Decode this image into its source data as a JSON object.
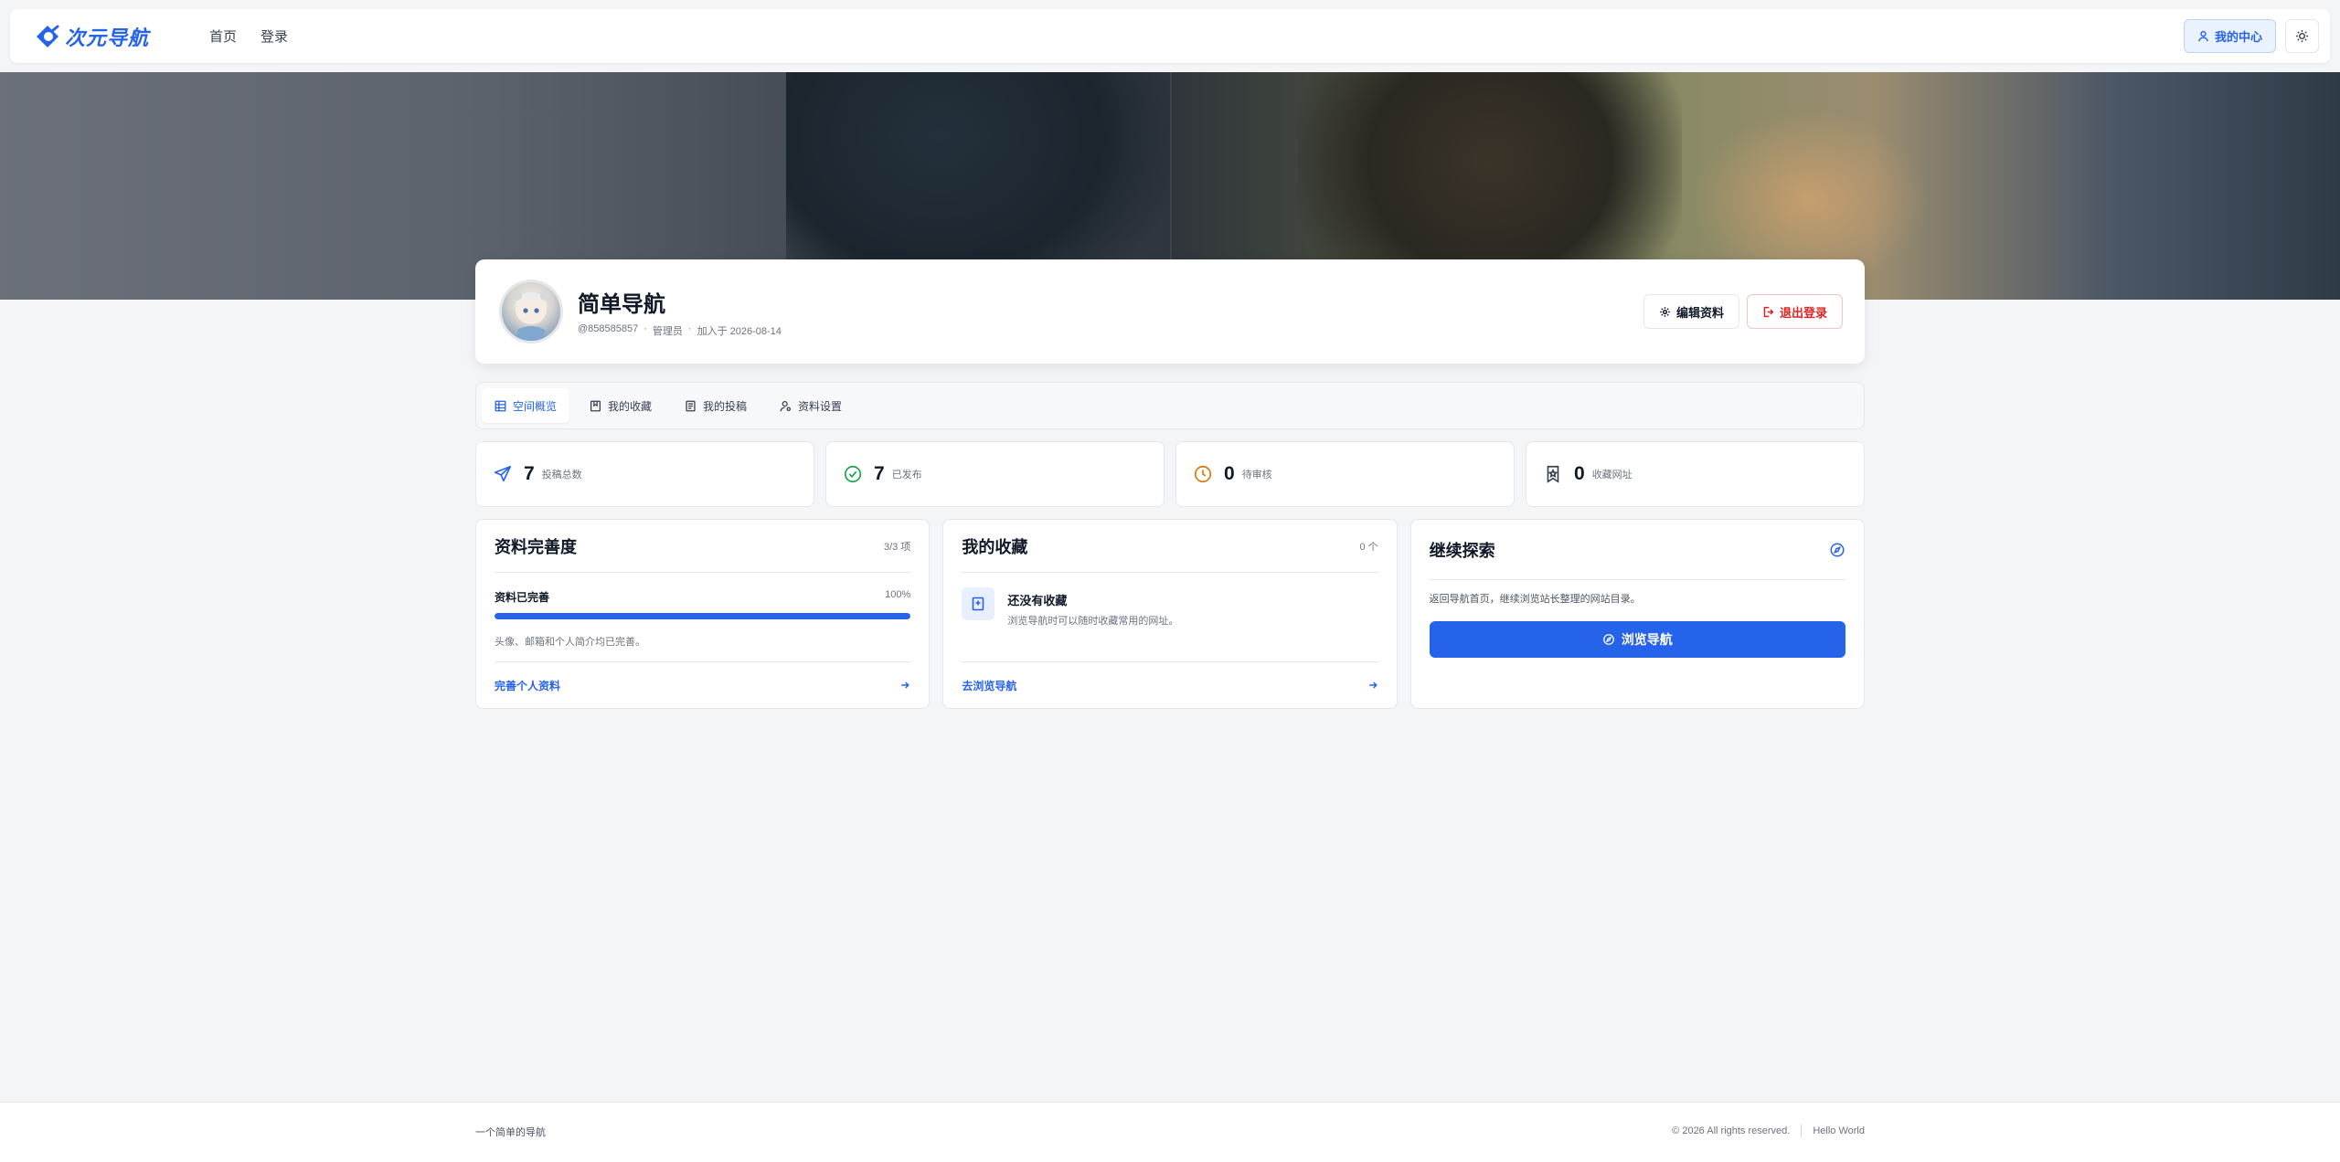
{
  "header": {
    "logo_text": "次元导航",
    "nav": [
      "首页",
      "登录"
    ],
    "center_label": "我的中心"
  },
  "profile": {
    "name": "简单导航",
    "handle": "@858585857",
    "role": "管理员",
    "joined": "加入于 2026-08-14",
    "edit_label": "编辑资料",
    "logout_label": "退出登录"
  },
  "tabs": [
    {
      "label": "空间概览",
      "icon": "grid-icon",
      "active": true
    },
    {
      "label": "我的收藏",
      "icon": "bookmark-icon",
      "active": false
    },
    {
      "label": "我的投稿",
      "icon": "document-icon",
      "active": false
    },
    {
      "label": "资料设置",
      "icon": "user-settings-icon",
      "active": false
    }
  ],
  "stats": [
    {
      "value": "7",
      "label": "投稿总数",
      "icon": "send-icon",
      "color": "#2563eb"
    },
    {
      "value": "7",
      "label": "已发布",
      "icon": "check-circle-icon",
      "color": "#16a34a"
    },
    {
      "value": "0",
      "label": "待审核",
      "icon": "clock-icon",
      "color": "#d97706"
    },
    {
      "value": "0",
      "label": "收藏网址",
      "icon": "bookmark-star-icon",
      "color": "#374151"
    }
  ],
  "completeness": {
    "title": "资料完善度",
    "count": "3/3 项",
    "status": "资料已完善",
    "percent_text": "100%",
    "percent": 100,
    "note": "头像、邮箱和个人简介均已完善。",
    "link": "完善个人资料"
  },
  "favorites": {
    "title": "我的收藏",
    "count": "0 个",
    "empty_title": "还没有收藏",
    "empty_desc": "浏览导航时可以随时收藏常用的网址。",
    "link": "去浏览导航"
  },
  "explore": {
    "title": "继续探索",
    "desc": "返回导航首页，继续浏览站长整理的网站目录。",
    "button": "浏览导航"
  },
  "footer": {
    "left": "一个简单的导航",
    "copyright": "© 2026 All rights reserved.",
    "hello": "Hello World"
  },
  "colors": {
    "accent": "#2563eb",
    "danger": "#dc2626",
    "background": "#f4f5f7"
  }
}
